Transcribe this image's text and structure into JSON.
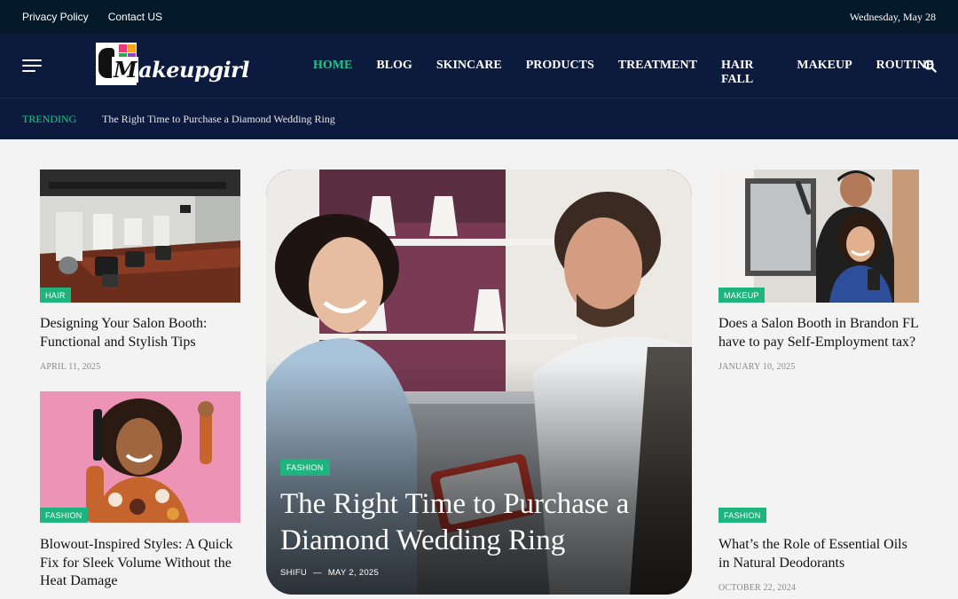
{
  "topbar": {
    "links": [
      "Privacy Policy",
      "Contact US"
    ],
    "date": "Wednesday, May 28"
  },
  "header": {
    "logo_text": "Makeupgirl",
    "nav": [
      "HOME",
      "BLOG",
      "SKINCARE",
      "PRODUCTS",
      "TREATMENT",
      "HAIR FALL",
      "MAKEUP",
      "ROUTINE"
    ],
    "active_nav": "HOME"
  },
  "trending": {
    "label": "TRENDING",
    "headline": "The Right Time to Purchase a Diamond Wedding Ring"
  },
  "cards": {
    "left_top": {
      "category": "HAIR",
      "title": "Designing Your Salon Booth: Functional and Stylish Tips",
      "date": "APRIL 11, 2025"
    },
    "left_bottom": {
      "category": "FASHION",
      "title": "Blowout-Inspired Styles: A Quick Fix for Sleek Volume Without the Heat Damage",
      "date": ""
    },
    "right_top": {
      "category": "MAKEUP",
      "title": "Does a Salon Booth in Brandon FL have to pay Self-Employment tax?",
      "date": "JANUARY 10, 2025"
    },
    "right_bottom": {
      "category": "FASHION",
      "title": "What’s the Role of Essential Oils in Natural Deodorants",
      "date": "OCTOBER 22, 2024"
    }
  },
  "featured": {
    "category": "FASHION",
    "title": "The Right Time to Purchase a Diamond Wedding Ring",
    "author": "SHIFU",
    "separator": "—",
    "date": "MAY 2, 2025"
  },
  "colors": {
    "topbar": "#04192a",
    "header": "#0c1a3e",
    "accent": "#22c58f",
    "tag": "#1fb37e",
    "page_bg": "#f3f3f3"
  },
  "icons": [
    "hamburger-menu-icon",
    "search-icon"
  ]
}
